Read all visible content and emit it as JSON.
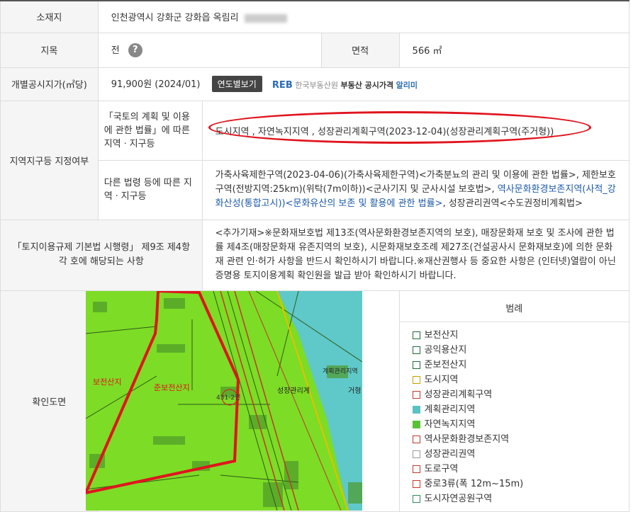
{
  "rows": {
    "location_label": "소재지",
    "location_value": "인천광역시 강화군 강화읍 옥림리",
    "jimok_label": "지목",
    "jimok_value": "전",
    "area_label": "면적",
    "area_value": "566 ㎡",
    "price_label": "개별공시지가(㎡당)",
    "price_value": "91,900원 (2024/01)",
    "year_button": "연도별보기",
    "reb_logo": "REB",
    "reb_text": "한국부동산원",
    "reb_service": "부동산 공시가격",
    "reb_app": "알리미"
  },
  "zoning": {
    "label": "지역지구등 지정여부",
    "sub1_label": "「국토의 계획 및 이용에 관한 법률」에 따른 지역ㆍ지구등",
    "sub1_value": "도시지역 , 자연녹지지역 , 성장관리계획구역(2023-12-04)(성장관리계획구역(주거형))",
    "sub2_label": "다른 법령 등에 따른 지역ㆍ지구등",
    "sub2_part1": "가축사육제한구역(2023-04-06)(가축사육제한구역)<가축분뇨의 관리 및 이용에 관한 법률>, 제한보호구역(전방지역:25km)(위탁(7m이하))<군사기지 및 군사시설 보호법>, ",
    "sub2_link": "역사문화환경보존지역(사적_강화산성(통합고시))<문화유산의 보존 및 활용에 관한 법률>",
    "sub2_part2": ", 성장관리권역<수도권정비계획법>"
  },
  "regulation": {
    "label": "「토지이용규제 기본법 시행령」 제9조 제4항 각 호에 해당되는 사항",
    "value": "<추가기재>※문화재보호법 제13조(역사문화환경보존지역의 보호), 매장문화재 보호 및 조사에 관한 법률 제4조(매장문화재 유존지역의 보호), 시문화재보호조례 제27조(건설공사시 문화재보호)에 의한 문화재 관련 인·허가 사항을 반드시 확인하시기 바랍니다.※재산권행사 등 중요한 사항은 (인터넷)열람이 아닌 증명용 토지이용계획 확인원을 발급 받아 확인하시기 바랍니다."
  },
  "map": {
    "label": "확인도면",
    "labels": {
      "bojeon": "보전산지",
      "junbojeon": "준보전산지",
      "parcel": "431-2전",
      "growth": "성장관리계",
      "plan": "계획관리지역",
      "suffix": "거형"
    }
  },
  "legend": {
    "title": "범례",
    "items": [
      {
        "label": "보전산지",
        "color": "#1f6b3a",
        "fill": "#ffffff"
      },
      {
        "label": "공익용산지",
        "color": "#1f6b3a",
        "fill": "#ffffff"
      },
      {
        "label": "준보전산지",
        "color": "#1f6b3a",
        "fill": "#ffffff"
      },
      {
        "label": "도시지역",
        "color": "#c8a000",
        "fill": "#ffffff"
      },
      {
        "label": "성장관리계획구역",
        "color": "#c0392b",
        "fill": "#ffffff"
      },
      {
        "label": "계획관리지역",
        "color": "#59c3c3",
        "fill": "#59c3c3"
      },
      {
        "label": "자연녹지지역",
        "color": "#5bc236",
        "fill": "#5bc236"
      },
      {
        "label": "역사문화환경보존지역",
        "color": "#c0392b",
        "fill": "#ffffff"
      },
      {
        "label": "성장관리권역",
        "color": "#999999",
        "fill": "#ffffff"
      },
      {
        "label": "도로구역",
        "color": "#c0392b",
        "fill": "#ffffff"
      },
      {
        "label": "중로3류(폭 12m~15m)",
        "color": "#c0392b",
        "fill": "#ffffff"
      },
      {
        "label": "도시자연공원구역",
        "color": "#2e8b57",
        "fill": "#ffffff"
      }
    ]
  }
}
